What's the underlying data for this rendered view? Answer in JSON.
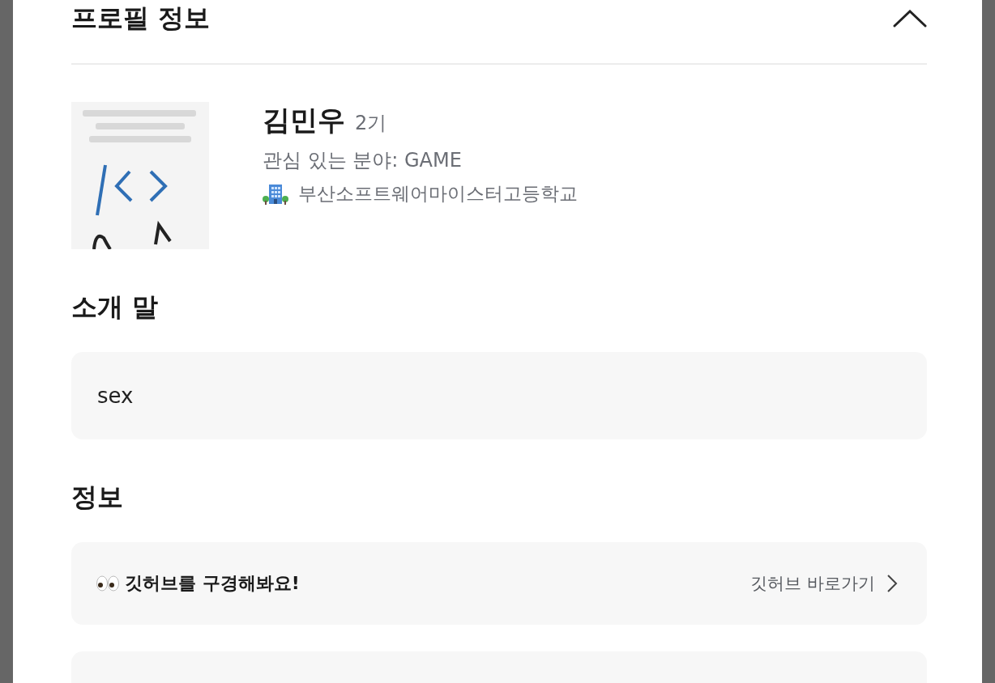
{
  "modal": {
    "title": "프로필 정보"
  },
  "profile": {
    "name": "김민우",
    "generation": "2기",
    "interest": "관심 있는 분야: GAME",
    "school": "부산소프트웨어마이스터고등학교"
  },
  "intro": {
    "heading": "소개 말",
    "text": "sex"
  },
  "info": {
    "heading": "정보",
    "items": [
      {
        "kind": "link",
        "title": "깃허브를 구경해봐요!",
        "action": "깃허브 바로가기"
      },
      {
        "kind": "empty"
      }
    ]
  }
}
